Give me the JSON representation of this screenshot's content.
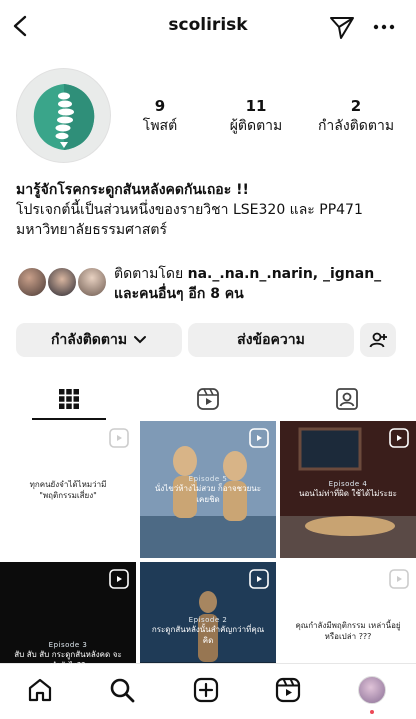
{
  "header": {
    "username": "scolirisk"
  },
  "stats": [
    {
      "value": "9",
      "label": "โพสต์"
    },
    {
      "value": "11",
      "label": "ผู้ติดตาม"
    },
    {
      "value": "2",
      "label": "กำลังติดตาม"
    }
  ],
  "bio": {
    "line1": "มารู้จักโรคกระดูกสันหลังคดกันเถอะ !!",
    "line2": "โปรเจกต์นี้เป็นส่วนหนึ่งของรายวิชา LSE320 และ PP471",
    "line3": "มหาวิทยาลัยธรรมศาสตร์"
  },
  "followed_by": {
    "prefix": "ติดตามโดย",
    "names": "na._.na.n_.narin, _ignan_",
    "suffix": "และคนอื่นๆ อีก 8 คน"
  },
  "buttons": {
    "following": "กำลังติดตาม",
    "message": "ส่งข้อความ"
  },
  "tabs": [
    {
      "icon": "grid-icon",
      "active": true
    },
    {
      "icon": "reels-icon",
      "active": false
    },
    {
      "icon": "tagged-icon",
      "active": false
    }
  ],
  "posts": [
    {
      "caption": "ทุกคนยังจำได้ไหมว่ามี \"พฤติกรรมเสี่ยง\"",
      "episode": "",
      "bg": "#ffffff",
      "fg": "#222222"
    },
    {
      "caption": "นั่งไขว่ห้างไม่สวย ก็อาจชวยนะเคยชิด",
      "episode": "Episode 5",
      "bg": "#8aa4bd",
      "fg": "#ffffff"
    },
    {
      "caption": "นอนไม่ท่าที่ผิด ใช้ได้ไม่ระยะ",
      "episode": "Episode 4",
      "bg": "#5a2a26",
      "fg": "#ffffff"
    },
    {
      "caption": "สับ สับ สับ กระดูกสันหลังคด จะทำยังไง??",
      "episode": "Episode 3",
      "bg": "#0c0c0c",
      "fg": "#ffffff"
    },
    {
      "caption": "กระดูกสันหลังนั้นสำคัญกว่าที่คุณคิด",
      "episode": "Episode 2",
      "bg": "#1f3b57",
      "fg": "#ffffff"
    },
    {
      "caption": "คุณกำลังมีพฤติกรรม เหล่านี้อยู่หรือเปล่า ???",
      "episode": "",
      "bg": "#ffffff",
      "fg": "#222222"
    }
  ],
  "bottom_nav": [
    "home-icon",
    "search-icon",
    "create-icon",
    "reels-icon",
    "profile-avatar"
  ]
}
